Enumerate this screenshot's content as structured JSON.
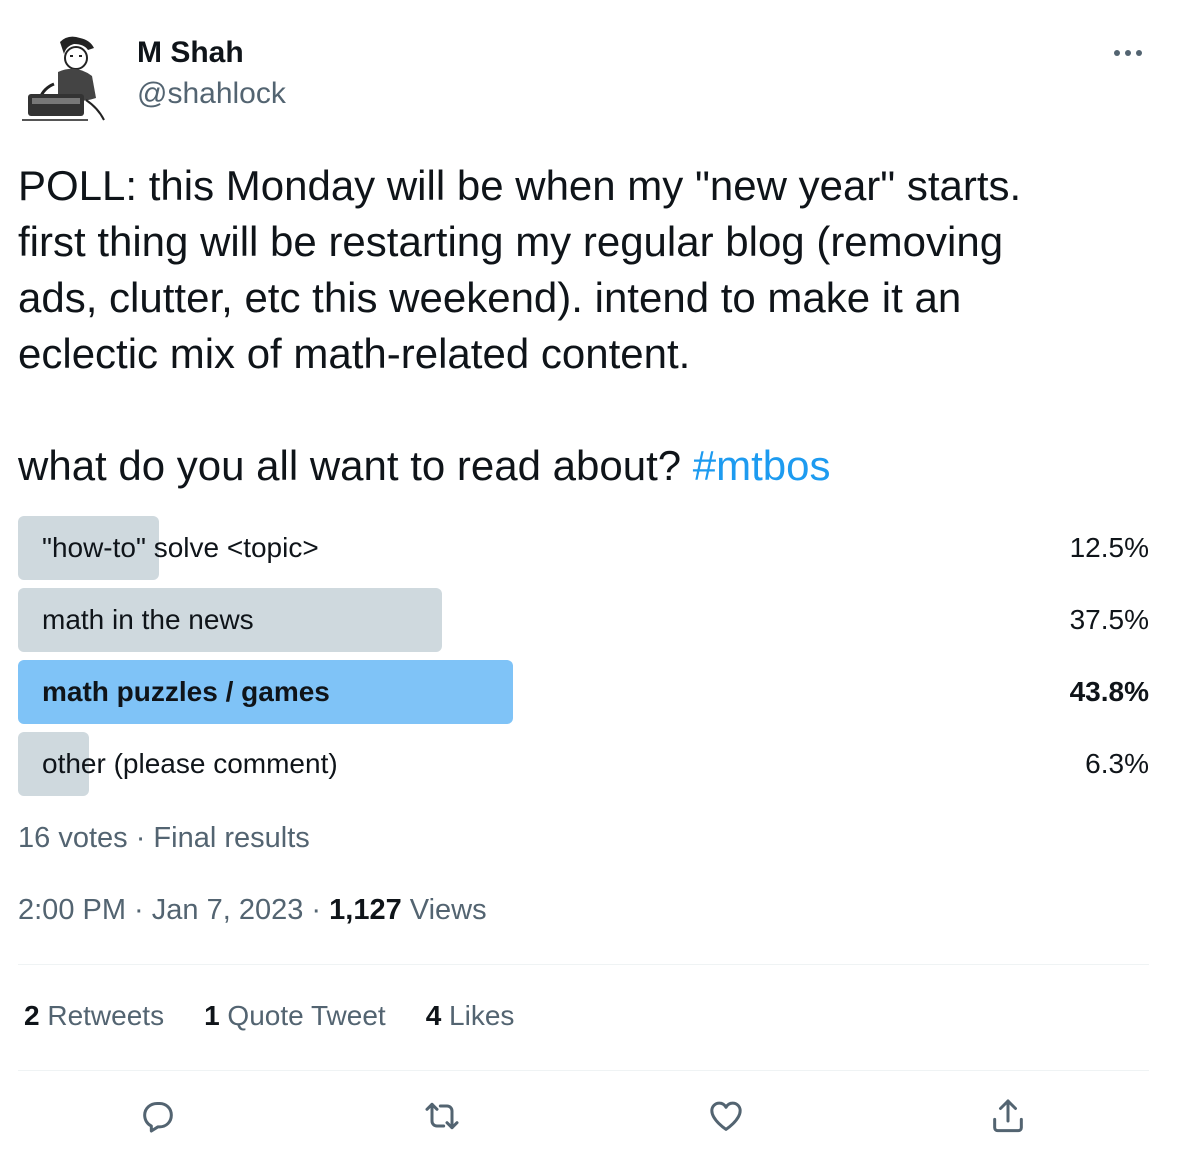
{
  "author": {
    "name": "M Shah",
    "handle": "@shahlock"
  },
  "tweet": {
    "lines": [
      "POLL: this Monday will be when my \"new year\" starts.",
      "first thing will be restarting my regular blog (removing",
      "ads, clutter, etc this weekend). intend to make it an",
      "eclectic mix of math-related content."
    ],
    "question": "what do you all want to read about? ",
    "hashtag": "#mtbos"
  },
  "poll": {
    "options": [
      {
        "label": "\"how-to\" solve <topic>",
        "percent_text": "12.5%",
        "percent": 12.5,
        "winner": false
      },
      {
        "label": "math in the news",
        "percent_text": "37.5%",
        "percent": 37.5,
        "winner": false
      },
      {
        "label": "math puzzles / games",
        "percent_text": "43.8%",
        "percent": 43.8,
        "winner": true
      },
      {
        "label": "other (please comment)",
        "percent_text": "6.3%",
        "percent": 6.3,
        "winner": false
      }
    ],
    "votes": "16 votes",
    "separator": " · ",
    "status": "Final results"
  },
  "timestamp": {
    "time": "2:00 PM",
    "separator": " · ",
    "date": "Jan 7, 2023",
    "views_count": "1,127",
    "views_label": " Views"
  },
  "stats": {
    "retweets_count": "2",
    "retweets_label": " Retweets",
    "quotes_count": "1",
    "quotes_label": " Quote Tweet",
    "likes_count": "4",
    "likes_label": " Likes"
  },
  "icons": {
    "reply": "reply-icon",
    "retweet": "retweet-icon",
    "like": "heart-icon",
    "share": "share-icon",
    "more": "more-icon"
  },
  "colors": {
    "accent": "#1d9bf0",
    "winner_bar": "#7fc3f7",
    "bar": "#cfd9de",
    "secondary_text": "#536471"
  }
}
